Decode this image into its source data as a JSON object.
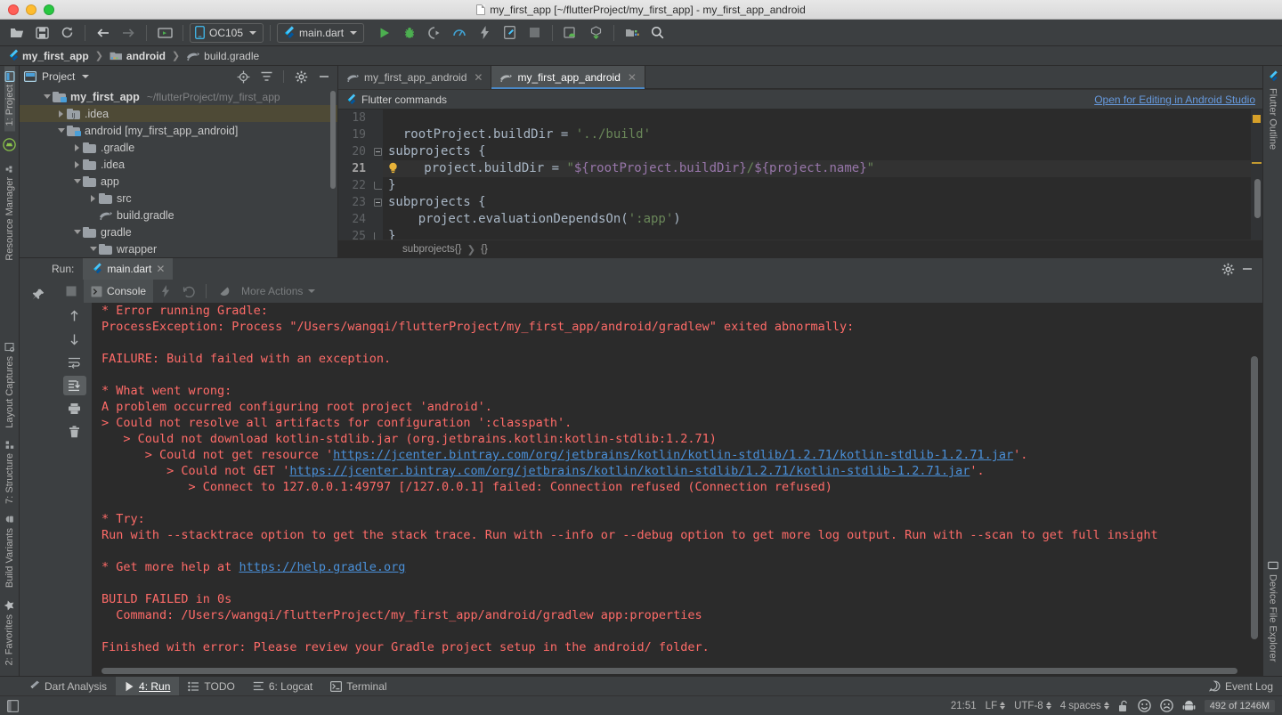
{
  "window": {
    "title": "my_first_app [~/flutterProject/my_first_app] - my_first_app_android",
    "traffic": [
      "close",
      "minimize",
      "zoom"
    ]
  },
  "toolbar": {
    "buttons": [
      {
        "name": "open-project-icon",
        "label": "Open"
      },
      {
        "name": "save-all-icon",
        "label": "Save All"
      },
      {
        "name": "sync-icon",
        "label": "Sync Project"
      },
      {
        "name": "back-arrow-icon",
        "label": "Back"
      },
      {
        "name": "forward-arrow-icon",
        "label": "Forward"
      },
      {
        "name": "avd-manager-icon",
        "label": "AVD Manager"
      }
    ],
    "device_selector": "OC105",
    "run_config": "main.dart",
    "actions": [
      {
        "name": "run-icon",
        "label": "Run"
      },
      {
        "name": "debug-icon",
        "label": "Debug"
      },
      {
        "name": "run-coverage-icon",
        "label": "Run with Coverage"
      },
      {
        "name": "profile-icon",
        "label": "Profile"
      },
      {
        "name": "hot-reload-icon",
        "label": "Hot Reload"
      },
      {
        "name": "flutter-attach-icon",
        "label": "Flutter Attach"
      },
      {
        "name": "stop-icon",
        "label": "Stop"
      },
      {
        "name": "sdk-manager-icon",
        "label": "SDK Manager"
      },
      {
        "name": "device-manager-icon",
        "label": "Device Manager"
      },
      {
        "name": "project-structure-icon",
        "label": "Project Structure"
      },
      {
        "name": "search-icon",
        "label": "Search Everywhere"
      }
    ]
  },
  "breadcrumb": {
    "items": [
      {
        "label": "my_first_app",
        "icon": "flutter-icon"
      },
      {
        "label": "android",
        "icon": "module-icon"
      },
      {
        "label": "build.gradle",
        "icon": "gradle-icon"
      }
    ]
  },
  "left_rail": {
    "top": [
      {
        "label": "1: Project",
        "selected": true,
        "icon": "project-icon"
      },
      {
        "label": "Resource Manager",
        "selected": false,
        "icon": "resource-icon"
      }
    ],
    "bottom": [
      {
        "label": "Layout Captures",
        "icon": "layout-captures-icon"
      },
      {
        "label": "7: Structure",
        "icon": "structure-icon"
      },
      {
        "label": "Build Variants",
        "icon": "android-icon"
      },
      {
        "label": "2: Favorites",
        "icon": "star-icon"
      }
    ]
  },
  "right_rail": {
    "items": [
      {
        "label": "Flutter Outline",
        "icon": "flutter-icon"
      },
      {
        "label": "Device File Explorer",
        "icon": "device-file-icon"
      }
    ]
  },
  "project_panel": {
    "title": "Project",
    "header_icons": [
      "locate-icon",
      "collapse-all-icon",
      "gear-icon",
      "hide-icon"
    ],
    "tree": [
      {
        "label": "my_first_app",
        "path": "~/flutterProject/my_first_app",
        "indent": 0,
        "expanded": true,
        "icon": "module-folder-icon",
        "bold": true,
        "selected": false
      },
      {
        "label": ".idea",
        "path": "",
        "indent": 1,
        "expanded": false,
        "icon": "idea-folder-icon",
        "bold": false,
        "selected": true
      },
      {
        "label": "android [my_first_app_android]",
        "path": "",
        "indent": 1,
        "expanded": true,
        "icon": "module-folder-icon",
        "bold": false,
        "selected": false
      },
      {
        "label": ".gradle",
        "path": "",
        "indent": 2,
        "expanded": false,
        "icon": "folder-icon",
        "bold": false,
        "selected": false
      },
      {
        "label": ".idea",
        "path": "",
        "indent": 2,
        "expanded": false,
        "icon": "folder-icon",
        "bold": false,
        "selected": false
      },
      {
        "label": "app",
        "path": "",
        "indent": 2,
        "expanded": true,
        "icon": "folder-icon",
        "bold": false,
        "selected": false
      },
      {
        "label": "src",
        "path": "",
        "indent": 3,
        "expanded": false,
        "icon": "folder-icon",
        "bold": false,
        "selected": false
      },
      {
        "label": "build.gradle",
        "path": "",
        "indent": 3,
        "expanded": null,
        "icon": "gradle-icon",
        "bold": false,
        "selected": false
      },
      {
        "label": "gradle",
        "path": "",
        "indent": 2,
        "expanded": true,
        "icon": "folder-icon",
        "bold": false,
        "selected": false
      },
      {
        "label": "wrapper",
        "path": "",
        "indent": 3,
        "expanded": true,
        "icon": "folder-icon",
        "bold": false,
        "selected": false
      }
    ]
  },
  "editor": {
    "tabs": [
      {
        "label": "my_first_app_android",
        "icon": "gradle-icon",
        "active": false
      },
      {
        "label": "my_first_app_android",
        "icon": "gradle-icon",
        "active": true
      }
    ],
    "banner": {
      "label": "Flutter commands",
      "icon": "flutter-icon",
      "link": "Open for Editing in Android Studio"
    },
    "first_line": 18,
    "current_line": 21,
    "lines": [
      {
        "n": 18,
        "text": ""
      },
      {
        "n": 19,
        "text": "  rootProject.buildDir = '../build'"
      },
      {
        "n": 20,
        "text": "subprojects {"
      },
      {
        "n": 21,
        "text": "    project.buildDir = \"${rootProject.buildDir}/${project.name}\""
      },
      {
        "n": 22,
        "text": "}"
      },
      {
        "n": 23,
        "text": "subprojects {"
      },
      {
        "n": 24,
        "text": "    project.evaluationDependsOn(':app')"
      },
      {
        "n": 25,
        "text": "}"
      }
    ],
    "code_breadcrumb": [
      "subprojects{}",
      "{}"
    ]
  },
  "run_window": {
    "label": "Run:",
    "tab": {
      "label": "main.dart",
      "icon": "dart-icon"
    },
    "toolbar": {
      "stop_label": "",
      "console_tab": "Console",
      "more_actions": "More Actions"
    },
    "gutter_buttons": [
      {
        "name": "up-arrow-icon",
        "selected": false
      },
      {
        "name": "down-arrow-icon",
        "selected": false
      },
      {
        "name": "soft-wrap-icon",
        "selected": false
      },
      {
        "name": "scroll-to-end-icon",
        "selected": true
      },
      {
        "name": "print-icon",
        "selected": false
      },
      {
        "name": "clear-all-icon",
        "selected": false
      }
    ],
    "console_lines": [
      [
        {
          "t": "* Error running Gradle:"
        }
      ],
      [
        {
          "t": "ProcessException: Process \"/Users/wangqi/flutterProject/my_first_app/android/gradlew\" exited abnormally:"
        }
      ],
      [
        {
          "t": ""
        }
      ],
      [
        {
          "t": "FAILURE: Build failed with an exception."
        }
      ],
      [
        {
          "t": ""
        }
      ],
      [
        {
          "t": "* What went wrong:"
        }
      ],
      [
        {
          "t": "A problem occurred configuring root project 'android'."
        }
      ],
      [
        {
          "t": "> Could not resolve all artifacts for configuration ':classpath'."
        }
      ],
      [
        {
          "t": "   > Could not download kotlin-stdlib.jar (org.jetbrains.kotlin:kotlin-stdlib:1.2.71)"
        }
      ],
      [
        {
          "t": "      > Could not get resource '"
        },
        {
          "t": "https://jcenter.bintray.com/org/jetbrains/kotlin/kotlin-stdlib/1.2.71/kotlin-stdlib-1.2.71.jar",
          "link": true
        },
        {
          "t": "'."
        }
      ],
      [
        {
          "t": "         > Could not GET '"
        },
        {
          "t": "https://jcenter.bintray.com/org/jetbrains/kotlin/kotlin-stdlib/1.2.71/kotlin-stdlib-1.2.71.jar",
          "link": true
        },
        {
          "t": "'."
        }
      ],
      [
        {
          "t": "            > Connect to 127.0.0.1:49797 [/127.0.0.1] failed: Connection refused (Connection refused)"
        }
      ],
      [
        {
          "t": ""
        }
      ],
      [
        {
          "t": "* Try:"
        }
      ],
      [
        {
          "t": "Run with --stacktrace option to get the stack trace. Run with --info or --debug option to get more log output. Run with --scan to get full insight"
        }
      ],
      [
        {
          "t": ""
        }
      ],
      [
        {
          "t": "* Get more help at "
        },
        {
          "t": "https://help.gradle.org",
          "link": true
        }
      ],
      [
        {
          "t": ""
        }
      ],
      [
        {
          "t": "BUILD FAILED in 0s"
        }
      ],
      [
        {
          "t": "  Command: /Users/wangqi/flutterProject/my_first_app/android/gradlew app:properties"
        }
      ],
      [
        {
          "t": ""
        }
      ],
      [
        {
          "t": "Finished with error: Please review your Gradle project setup in the android/ folder."
        }
      ]
    ]
  },
  "status_tabs": {
    "items": [
      {
        "label": "Dart Analysis",
        "icon": "dart-icon",
        "selected": false,
        "underline": ""
      },
      {
        "label": "4: Run",
        "icon": "run-icon",
        "selected": true,
        "underline": "4"
      },
      {
        "label": "TODO",
        "icon": "todo-icon",
        "selected": false,
        "underline": ""
      },
      {
        "label": "6: Logcat",
        "icon": "logcat-icon",
        "selected": false,
        "underline": "6"
      },
      {
        "label": "Terminal",
        "icon": "terminal-icon",
        "selected": false,
        "underline": ""
      }
    ],
    "event_log": "Event Log"
  },
  "status_bar": {
    "time": "21:51",
    "line_sep": "LF",
    "encoding": "UTF-8",
    "indent": "4 spaces",
    "lock_icon": "unlocked-icon",
    "faces": [
      "smiley-happy-icon",
      "smiley-sad-icon",
      "android-robot-icon"
    ],
    "memory": "492 of 1246M"
  },
  "colors": {
    "accent_blue": "#4a88c7",
    "link_blue": "#6699dd",
    "error_red": "#ff6b68",
    "string_green": "#6a8759",
    "keyword_orange": "#cc7832",
    "selection_olive": "#4e4a36",
    "panel_bg": "#3c3f41",
    "editor_bg": "#2b2b2b"
  }
}
